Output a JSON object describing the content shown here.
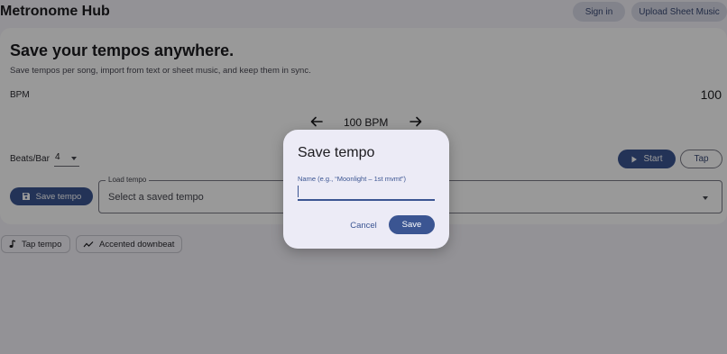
{
  "header": {
    "app_title": "Metronome Hub",
    "signin_label": "Sign in",
    "upload_label": "Upload Sheet Music"
  },
  "hero": {
    "title": "Save your tempos anywhere.",
    "subtitle": "Save tempos per song, import from text or sheet music, and keep them in sync."
  },
  "bpm": {
    "label": "BPM",
    "value": "100",
    "center_display": "100 BPM"
  },
  "beats": {
    "label": "Beats/Bar",
    "value": "4"
  },
  "transport": {
    "start_label": "Start",
    "tap_label": "Tap"
  },
  "tempo_actions": {
    "save_label": "Save tempo",
    "load_legend": "Load tempo",
    "load_placeholder": "Select a saved tempo"
  },
  "chips": {
    "tap_tempo": "Tap tempo",
    "accented_downbeat": "Accented downbeat"
  },
  "dialog": {
    "title": "Save tempo",
    "name_label": "Name (e.g., “Moonlight – 1st mvmt”)",
    "name_value": "",
    "cancel_label": "Cancel",
    "save_label": "Save"
  },
  "colors": {
    "primary": "#3b5592",
    "background": "#f5f3fa",
    "dialog_surface": "#ecebf6"
  }
}
